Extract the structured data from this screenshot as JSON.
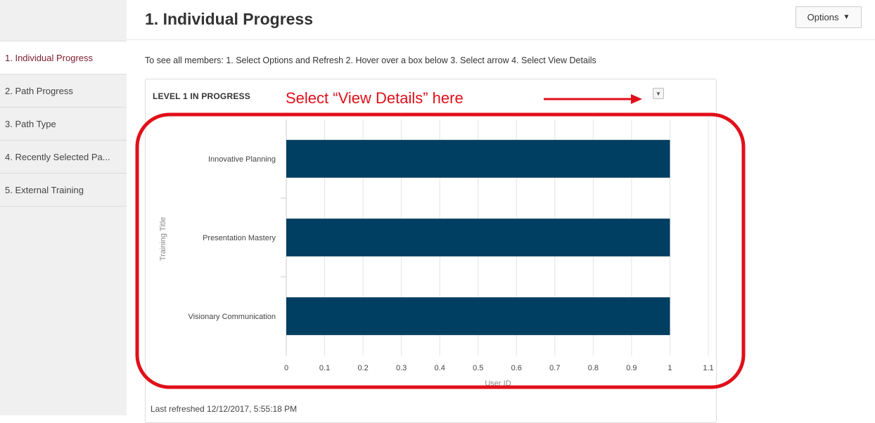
{
  "sidebar": {
    "items": [
      {
        "label": "1. Individual Progress",
        "active": true
      },
      {
        "label": "2. Path Progress",
        "active": false
      },
      {
        "label": "3. Path Type",
        "active": false
      },
      {
        "label": "4. Recently Selected Pa...",
        "active": false
      },
      {
        "label": "5. External Training",
        "active": false
      }
    ]
  },
  "header": {
    "title": "1. Individual Progress",
    "options_label": "Options"
  },
  "instructions": "To see all members: 1. Select Options and Refresh 2. Hover over a box below 3. Select arrow 4. Select View Details",
  "panel": {
    "title": "LEVEL 1 IN PROGRESS",
    "last_refreshed": "Last refreshed 12/12/2017, 5:55:18 PM"
  },
  "annotation": {
    "text": "Select “View Details” here",
    "color": "#e0101a"
  },
  "chart_data": {
    "type": "bar",
    "orientation": "horizontal",
    "categories": [
      "Innovative Planning",
      "Presentation Mastery",
      "Visionary Communication"
    ],
    "values": [
      1,
      1,
      1
    ],
    "xlabel": "User ID",
    "ylabel": "Training Title",
    "xlim": [
      0,
      1.1
    ],
    "xticks": [
      "0",
      "0.1",
      "0.2",
      "0.3",
      "0.4",
      "0.5",
      "0.6",
      "0.7",
      "0.8",
      "0.9",
      "1",
      "1.1"
    ],
    "bar_color": "#003e62",
    "grid": true
  }
}
